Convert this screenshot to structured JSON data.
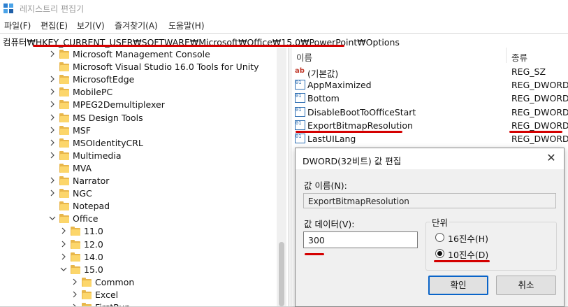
{
  "window": {
    "title": "레지스트리 편집기"
  },
  "menu": [
    "파일(F)",
    "편집(E)",
    "보기(V)",
    "즐겨찾기(A)",
    "도움말(H)"
  ],
  "address": "컴퓨터₩HKEY_CURRENT_USER₩SOFTWARE₩Microsoft₩Office₩15.0₩PowerPoint₩Options",
  "tree": [
    {
      "label": "Microsoft Management Console",
      "level": 0,
      "expander": "right"
    },
    {
      "label": "Microsoft Visual Studio 16.0 Tools for Unity",
      "level": 0,
      "expander": "none"
    },
    {
      "label": "MicrosoftEdge",
      "level": 0,
      "expander": "right"
    },
    {
      "label": "MobilePC",
      "level": 0,
      "expander": "right"
    },
    {
      "label": "MPEG2Demultiplexer",
      "level": 0,
      "expander": "right"
    },
    {
      "label": "MS Design Tools",
      "level": 0,
      "expander": "right"
    },
    {
      "label": "MSF",
      "level": 0,
      "expander": "right"
    },
    {
      "label": "MSOIdentityCRL",
      "level": 0,
      "expander": "right"
    },
    {
      "label": "Multimedia",
      "level": 0,
      "expander": "right"
    },
    {
      "label": "MVA",
      "level": 0,
      "expander": "none"
    },
    {
      "label": "Narrator",
      "level": 0,
      "expander": "right"
    },
    {
      "label": "NGC",
      "level": 0,
      "expander": "right"
    },
    {
      "label": "Notepad",
      "level": 0,
      "expander": "none"
    },
    {
      "label": "Office",
      "level": 0,
      "expander": "down"
    },
    {
      "label": "11.0",
      "level": 1,
      "expander": "right"
    },
    {
      "label": "12.0",
      "level": 1,
      "expander": "right"
    },
    {
      "label": "14.0",
      "level": 1,
      "expander": "right"
    },
    {
      "label": "15.0",
      "level": 1,
      "expander": "down"
    },
    {
      "label": "Common",
      "level": 2,
      "expander": "right"
    },
    {
      "label": "Excel",
      "level": 2,
      "expander": "right"
    },
    {
      "label": "FirstRun",
      "level": 2,
      "expander": "right"
    }
  ],
  "columns": {
    "name": "이름",
    "type": "종류"
  },
  "values": [
    {
      "icon": "string-value-icon",
      "name": "(기본값)",
      "type": "REG_SZ"
    },
    {
      "icon": "dword-value-icon",
      "name": "AppMaximized",
      "type": "REG_DWORD"
    },
    {
      "icon": "dword-value-icon",
      "name": "Bottom",
      "type": "REG_DWORD"
    },
    {
      "icon": "dword-value-icon",
      "name": "DisableBootToOfficeStart",
      "type": "REG_DWORD"
    },
    {
      "icon": "dword-value-icon",
      "name": "ExportBitmapResolution",
      "type": "REG_DWORD"
    },
    {
      "icon": "dword-value-icon",
      "name": "LastUILang",
      "type": "REG_DWORD"
    }
  ],
  "dialog": {
    "title": "DWORD(32비트) 값 편집",
    "name_label": "값 이름(N):",
    "name_value": "ExportBitmapResolution",
    "data_label": "값 데이터(V):",
    "data_value": "300",
    "base_label": "단위",
    "hex_label": "16진수(H)",
    "dec_label": "10진수(D)",
    "selected_base": "decimal",
    "ok_label": "확인",
    "cancel_label": "취소"
  },
  "colors": {
    "annotation_red": "#d40000",
    "folder": "#fcd66b",
    "accent": "#0a64c8"
  }
}
